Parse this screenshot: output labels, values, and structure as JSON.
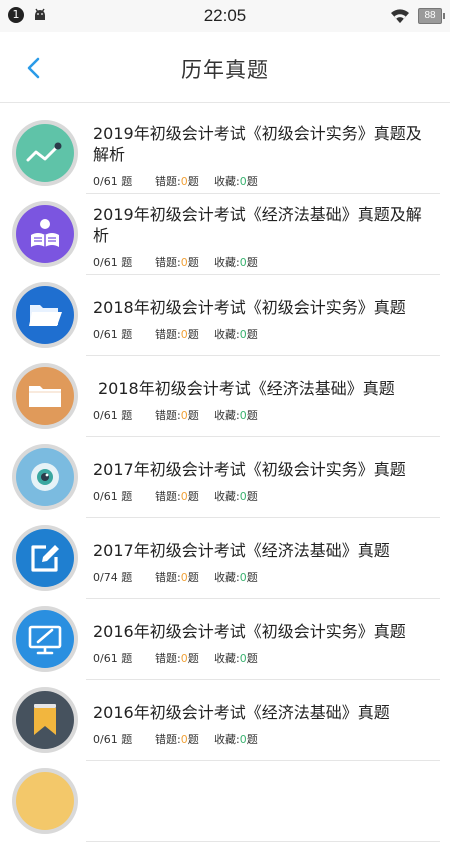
{
  "status_bar": {
    "notification_count": "1",
    "time": "22:05",
    "battery": "88"
  },
  "header": {
    "title": "历年真题"
  },
  "labels": {
    "wrong": "错题:",
    "fav": "收藏:",
    "unit": "题"
  },
  "colors": {
    "accent_back": "#2b9be8",
    "wrong_count": "#f0a23a",
    "fav_count": "#3cb371"
  },
  "items": [
    {
      "title": "2019年初级会计考试《初级会计实务》真题及解析",
      "progress": "0/61 题",
      "wrong": "0",
      "fav": "0",
      "icon": "line-chart-icon",
      "color": "#5fc3a8"
    },
    {
      "title": "2019年初级会计考试《经济法基础》真题及解析",
      "progress": "0/61 题",
      "wrong": "0",
      "fav": "0",
      "icon": "reader-icon",
      "color": "#7b55e0"
    },
    {
      "title": "2018年初级会计考试《初级会计实务》真题",
      "progress": "0/61 题",
      "wrong": "0",
      "fav": "0",
      "icon": "folder-open-icon",
      "color": "#1f6fd0"
    },
    {
      "title": "2018年初级会计考试《经济法基础》真题",
      "progress": "0/61 题",
      "wrong": "0",
      "fav": "0",
      "icon": "folder-icon",
      "color": "#e09a5a"
    },
    {
      "title": "2017年初级会计考试《初级会计实务》真题",
      "progress": "0/61 题",
      "wrong": "0",
      "fav": "0",
      "icon": "eye-icon",
      "color": "#7bbbe0"
    },
    {
      "title": "2017年初级会计考试《经济法基础》真题",
      "progress": "0/74 题",
      "wrong": "0",
      "fav": "0",
      "icon": "edit-icon",
      "color": "#1f7fd0"
    },
    {
      "title": "2016年初级会计考试《初级会计实务》真题",
      "progress": "0/61 题",
      "wrong": "0",
      "fav": "0",
      "icon": "monitor-edit-icon",
      "color": "#2a8fe0"
    },
    {
      "title": "2016年初级会计考试《经济法基础》真题",
      "progress": "0/61 题",
      "wrong": "0",
      "fav": "0",
      "icon": "bookmark-icon",
      "color": "#46525e"
    }
  ]
}
